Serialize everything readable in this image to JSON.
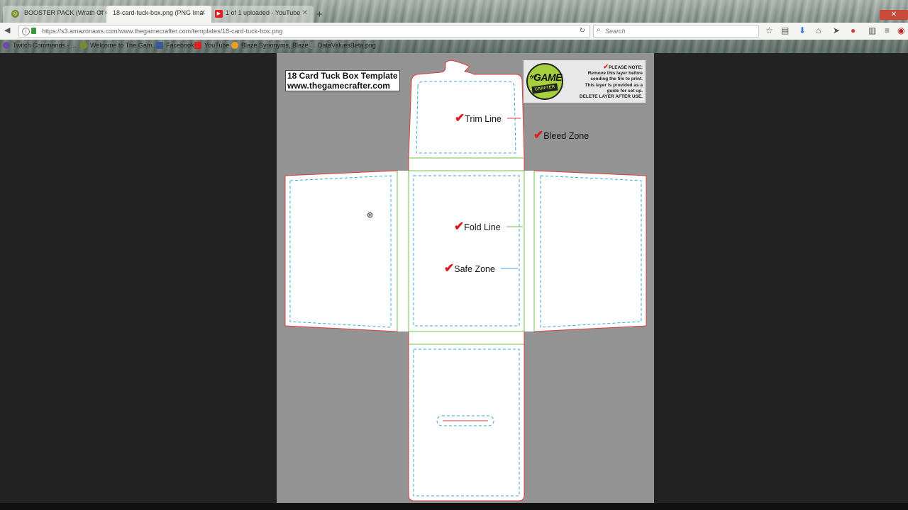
{
  "tabs": [
    {
      "label": "BOOSTER PACK (Wrath Of C",
      "icon": "game-crafter-favicon"
    },
    {
      "label": "18-card-tuck-box.png (PNG Ima",
      "icon": "none"
    },
    {
      "label": "1 of 1 uploaded - YouTube",
      "icon": "youtube-favicon"
    }
  ],
  "new_tab_label": "+",
  "address": {
    "url": "https://s3.amazonaws.com/www.thegamecrafter.com/templates/18-card-tuck-box.png"
  },
  "search": {
    "placeholder": "Search"
  },
  "bookmarks": [
    {
      "label": "Twitch Commands - ..."
    },
    {
      "label": "Welcome to The Gam..."
    },
    {
      "label": "Facebook"
    },
    {
      "label": "YouTube"
    },
    {
      "label": "Blaze Synonyms, Blaze ..."
    },
    {
      "label": "DataValuesBeta.png"
    }
  ],
  "template": {
    "title_line1": "18 Card Tuck Box Template",
    "title_line2": "www.thegamecrafter.com",
    "logo": {
      "the": "the",
      "game": "GAME",
      "crafter": "CRAFTER"
    },
    "note": {
      "heading": "PLEASE NOTE:",
      "line1": "Remove this layer before",
      "line2": "sending the file to print.",
      "line3": "This layer is provided as a",
      "line4": "guide for set up.",
      "line5": "DELETE LAYER AFTER USE."
    },
    "labels": {
      "trim": "Trim Line",
      "bleed": "Bleed Zone",
      "fold": "Fold Line",
      "safe": "Safe Zone"
    },
    "colors": {
      "trim": "#e23b3b",
      "fold": "#6cc04a",
      "safe": "#3aa6e0",
      "check": "#e01a1a",
      "logo_green": "#a5cf3c"
    }
  }
}
